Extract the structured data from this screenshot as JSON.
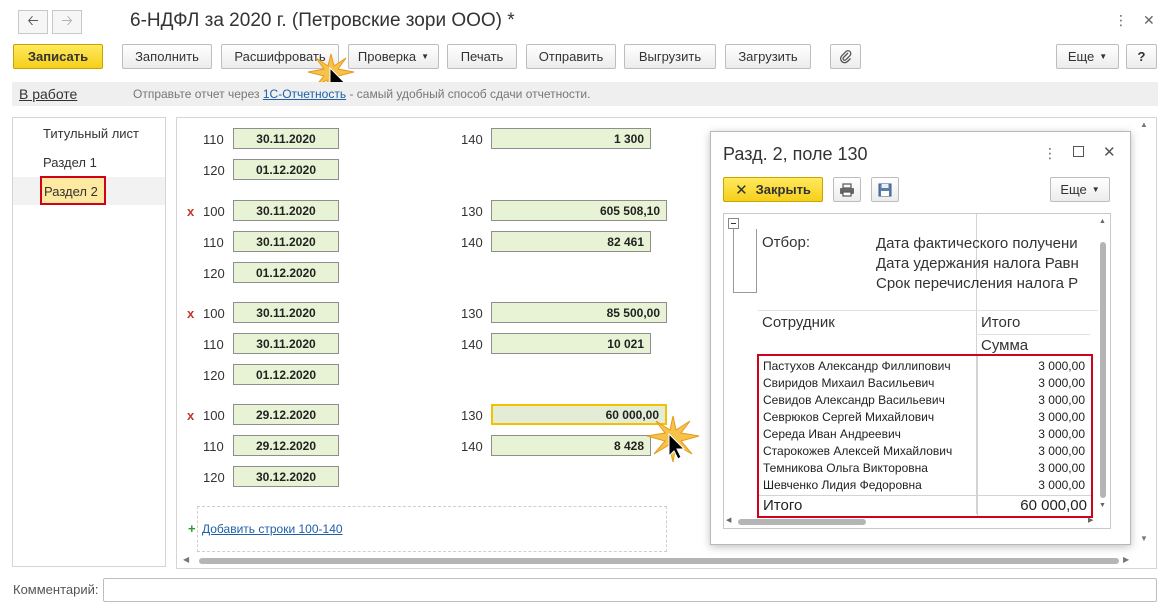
{
  "window": {
    "title": "6-НДФЛ за 2020 г. (Петровские зори ООО) *"
  },
  "toolbar": {
    "save": "Записать",
    "fill": "Заполнить",
    "decode": "Расшифровать",
    "check": "Проверка",
    "print": "Печать",
    "send": "Отправить",
    "export": "Выгрузить",
    "import": "Загрузить",
    "more": "Еще",
    "help": "?"
  },
  "status": {
    "state": "В работе",
    "msg_prefix": "Отправьте отчет через",
    "msg_link": "1С-Отчетность",
    "msg_suffix": "- самый удобный способ сдачи отчетности."
  },
  "sidebar": {
    "items": [
      {
        "label": "Титульный лист"
      },
      {
        "label": "Раздел 1"
      },
      {
        "label": "Раздел 2"
      }
    ]
  },
  "section": {
    "groups": [
      {
        "rows": [
          {
            "code": "110",
            "date": "30.11.2020",
            "rcode": "140",
            "rval": "1 300"
          },
          {
            "code": "120",
            "date": "01.12.2020"
          }
        ]
      },
      {
        "rows": [
          {
            "mark": "x",
            "code": "100",
            "date": "30.11.2020",
            "rcode": "130",
            "rval": "605 508,10"
          },
          {
            "code": "110",
            "date": "30.11.2020",
            "rcode": "140",
            "rval": "82 461"
          },
          {
            "code": "120",
            "date": "01.12.2020"
          }
        ]
      },
      {
        "rows": [
          {
            "mark": "x",
            "code": "100",
            "date": "30.11.2020",
            "rcode": "130",
            "rval": "85 500,00"
          },
          {
            "code": "110",
            "date": "30.11.2020",
            "rcode": "140",
            "rval": "10 021"
          },
          {
            "code": "120",
            "date": "01.12.2020"
          }
        ]
      },
      {
        "rows": [
          {
            "mark": "x",
            "code": "100",
            "date": "29.12.2020",
            "rcode": "130",
            "rval": "60 000,00"
          },
          {
            "code": "110",
            "date": "29.12.2020",
            "rcode": "140",
            "rval": "8 428"
          },
          {
            "code": "120",
            "date": "30.12.2020"
          }
        ]
      }
    ],
    "add_rows": "Добавить строки 100-140",
    "add_plus": "+"
  },
  "popup": {
    "title": "Разд. 2, поле 130",
    "close_btn": "Закрыть",
    "more": "Еще",
    "filter_label": "Отбор:",
    "filter_lines": [
      "Дата фактического получени",
      "Дата удержания налога Равн",
      "Срок перечисления налога Р"
    ],
    "col_employee": "Сотрудник",
    "col_total": "Итого",
    "col_sum": "Сумма",
    "employees": [
      {
        "name": "Пастухов Александр Филлипович",
        "value": "3 000,00"
      },
      {
        "name": "Свиридов Михаил Васильевич",
        "value": "3 000,00"
      },
      {
        "name": "Севидов Александр Васильевич",
        "value": "3 000,00"
      },
      {
        "name": "Севрюков Сергей Михайлович",
        "value": "3 000,00"
      },
      {
        "name": "Середа Иван Андреевич",
        "value": "3 000,00"
      },
      {
        "name": "Старокожев Алексей Михайлович",
        "value": "3 000,00"
      },
      {
        "name": "Темникова Ольга Викторовна",
        "value": "3 000,00"
      },
      {
        "name": "Шевченко Лидия Федоровна",
        "value": "3 000,00"
      }
    ],
    "total_label": "Итого",
    "total_value": "60 000,00"
  },
  "comment": {
    "label": "Комментарий:",
    "value": ""
  },
  "colors": {
    "accent_yellow": "#f5cf1b",
    "highlight_red": "#d0021b",
    "field_green": "#e8f3d6",
    "link_blue": "#1f5fa8"
  }
}
